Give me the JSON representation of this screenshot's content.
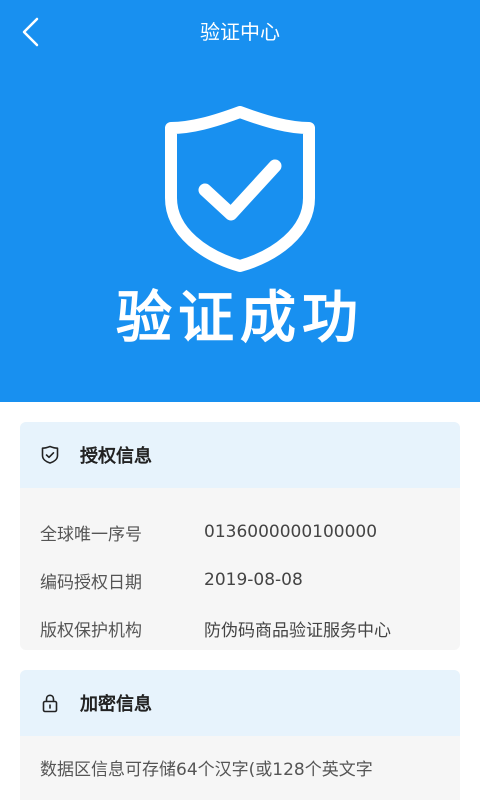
{
  "header": {
    "title": "验证中心",
    "back_icon": "chevron-left-icon"
  },
  "hero": {
    "status_text": "验证成功",
    "icon": "shield-check-icon",
    "background": "#1890f0"
  },
  "auth_card": {
    "title": "授权信息",
    "icon": "shield-check-icon",
    "rows": [
      {
        "label": "全球唯一序号",
        "value": "0136000000100000"
      },
      {
        "label": "编码授权日期",
        "value": "2019-08-08"
      },
      {
        "label": "版权保护机构",
        "value": "防伪码商品验证服务中心"
      }
    ]
  },
  "encryption_card": {
    "title": "加密信息",
    "icon": "lock-icon",
    "text": "数据区信息可存储64个汉字(或128个英文字"
  },
  "colors": {
    "primary": "#1890f0",
    "card_header": "#e7f3fc",
    "card_body": "#f6f6f6"
  }
}
